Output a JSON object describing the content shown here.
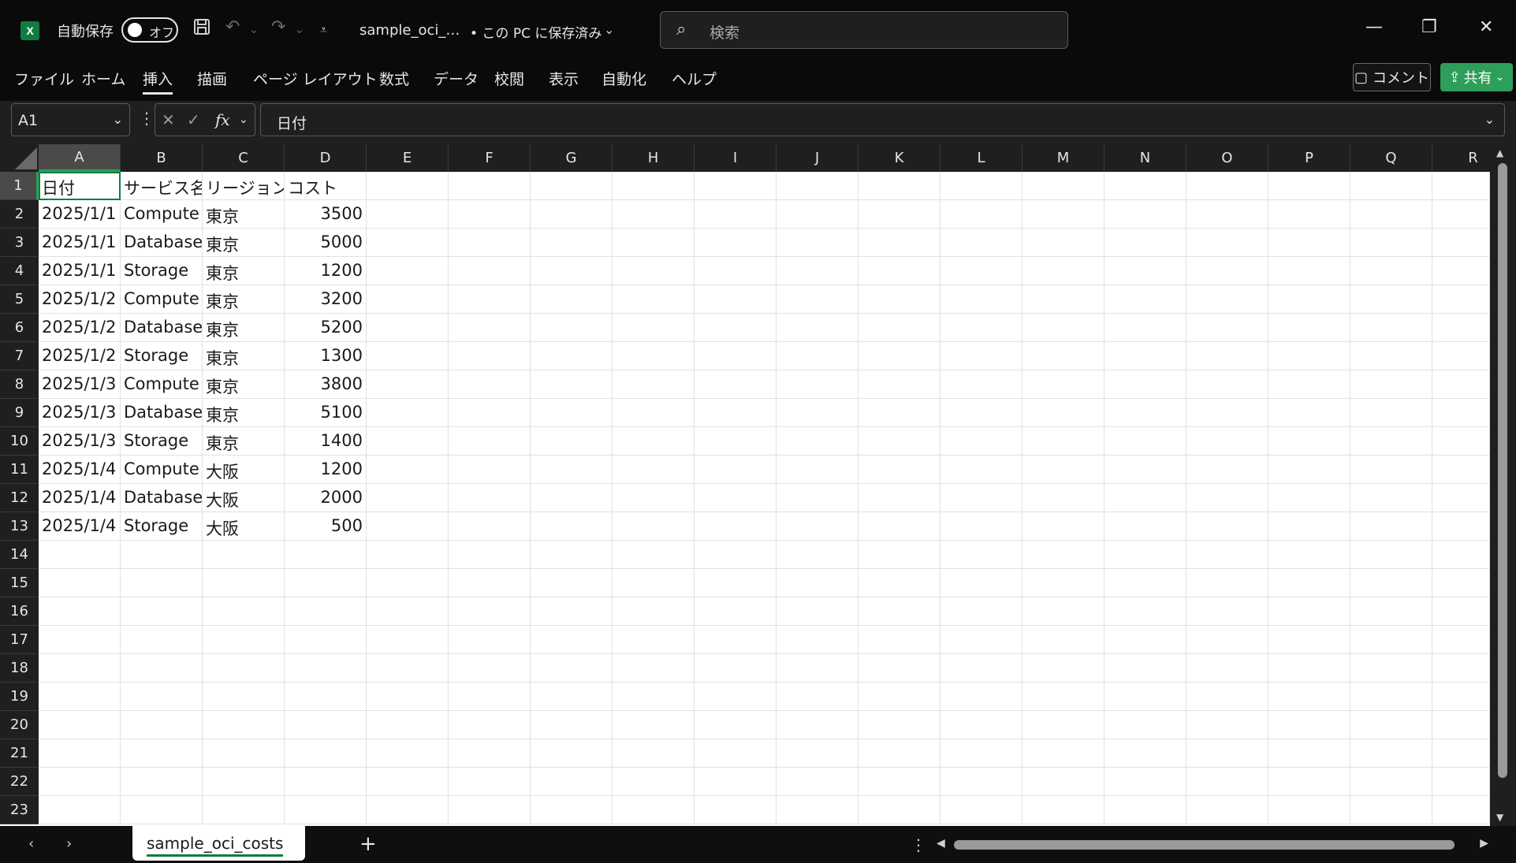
{
  "titlebar": {
    "app_logo": "X",
    "autosave_label": "自動保存",
    "autosave_state": "オフ",
    "filename": "sample_oci_…",
    "save_state": "• この PC に保存済み",
    "search_placeholder": "検索"
  },
  "ribbon": {
    "tabs": [
      "ファイル",
      "ホーム",
      "挿入",
      "描画",
      "ページ レイアウト",
      "数式",
      "データ",
      "校閲",
      "表示",
      "自動化",
      "ヘルプ"
    ],
    "active_tab_index": 2,
    "comment_label": "コメント",
    "share_label": "共有"
  },
  "formula_bar": {
    "name_box": "A1",
    "formula": "日付"
  },
  "columns": [
    "A",
    "B",
    "C",
    "D",
    "E",
    "F",
    "G",
    "H",
    "I",
    "J",
    "K",
    "L",
    "M",
    "N",
    "O",
    "P",
    "Q",
    "R"
  ],
  "rows": [
    "1",
    "2",
    "3",
    "4",
    "5",
    "6",
    "7",
    "8",
    "9",
    "10",
    "11",
    "12",
    "13",
    "14",
    "15",
    "16",
    "17",
    "18",
    "19",
    "20",
    "21",
    "22",
    "23"
  ],
  "table": {
    "header": [
      "日付",
      "サービス名",
      "リージョン",
      "コスト"
    ],
    "data": [
      [
        "2025/1/1",
        "Compute",
        "東京",
        "3500"
      ],
      [
        "2025/1/1",
        "Database",
        "東京",
        "5000"
      ],
      [
        "2025/1/1",
        "Storage",
        "東京",
        "1200"
      ],
      [
        "2025/1/2",
        "Compute",
        "東京",
        "3200"
      ],
      [
        "2025/1/2",
        "Database",
        "東京",
        "5200"
      ],
      [
        "2025/1/2",
        "Storage",
        "東京",
        "1300"
      ],
      [
        "2025/1/3",
        "Compute",
        "東京",
        "3800"
      ],
      [
        "2025/1/3",
        "Database",
        "東京",
        "5100"
      ],
      [
        "2025/1/3",
        "Storage",
        "東京",
        "1400"
      ],
      [
        "2025/1/4",
        "Compute",
        "大阪",
        "1200"
      ],
      [
        "2025/1/4",
        "Database",
        "大阪",
        "2000"
      ],
      [
        "2025/1/4",
        "Storage",
        "大阪",
        "500"
      ]
    ]
  },
  "sheets": {
    "active": "sample_oci_costs"
  },
  "colors": {
    "excel_green": "#107c41",
    "share_green": "#2e9e5b"
  }
}
